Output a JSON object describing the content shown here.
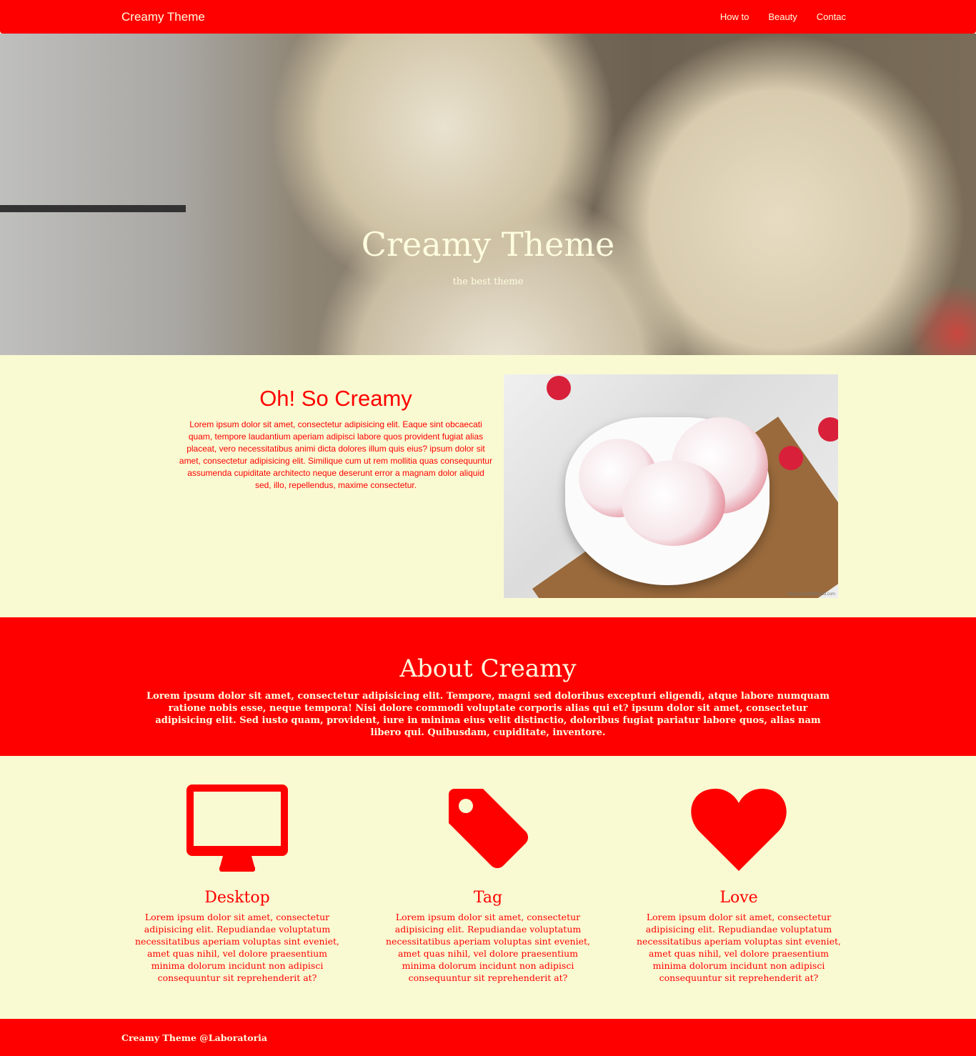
{
  "nav": {
    "brand": "Creamy Theme",
    "links": [
      "How to",
      "Beauty",
      "Contac"
    ]
  },
  "hero": {
    "title": "Creamy Theme",
    "subtitle": "the best theme"
  },
  "intro": {
    "heading": "Oh! So Creamy",
    "body": "Lorem ipsum dolor sit amet, consectetur adipisicing elit. Eaque sint obcaecati quam, tempore laudantium aperiam adipisci labore quos provident fugiat alias placeat, vero necessitatibus animi dicta dolores illum quis eius? ipsum dolor sit amet, consectetur adipisicing elit. Similique cum ut rem mollitia quas consequuntur assumenda cupiditate architecto neque deserunt error a magnam dolor aliquid sed, illo, repellendus, maxime consectetur.",
    "photo_credit": "twopeasandtheirpod.com"
  },
  "about": {
    "heading": "About Creamy",
    "body": "Lorem ipsum dolor sit amet, consectetur adipisicing elit. Tempore, magni sed doloribus excepturi eligendi, atque labore numquam ratione nobis esse, neque tempora! Nisi dolore commodi voluptate corporis alias qui et? ipsum dolor sit amet, consectetur adipisicing elit. Sed iusto quam, provident, iure in minima eius velit distinctio, doloribus fugiat pariatur labore quos, alias nam libero qui. Quibusdam, cupiditate, inventore."
  },
  "features": [
    {
      "icon": "desktop-icon",
      "title": "Desktop",
      "body": "Lorem ipsum dolor sit amet, consectetur adipisicing elit. Repudiandae voluptatum necessitatibus aperiam voluptas sint eveniet, amet quas nihil, vel dolore praesentium minima dolorum incidunt non adipisci consequuntur sit reprehenderit at?"
    },
    {
      "icon": "tag-icon",
      "title": "Tag",
      "body": "Lorem ipsum dolor sit amet, consectetur adipisicing elit. Repudiandae voluptatum necessitatibus aperiam voluptas sint eveniet, amet quas nihil, vel dolore praesentium minima dolorum incidunt non adipisci consequuntur sit reprehenderit at?"
    },
    {
      "icon": "heart-icon",
      "title": "Love",
      "body": "Lorem ipsum dolor sit amet, consectetur adipisicing elit. Repudiandae voluptatum necessitatibus aperiam voluptas sint eveniet, amet quas nihil, vel dolore praesentium minima dolorum incidunt non adipisci consequuntur sit reprehenderit at?"
    }
  ],
  "footer": {
    "text": "Creamy Theme @Laboratoria"
  },
  "colors": {
    "accent": "#ff0000",
    "background": "#fafad2",
    "light_text": "#fffde0"
  }
}
